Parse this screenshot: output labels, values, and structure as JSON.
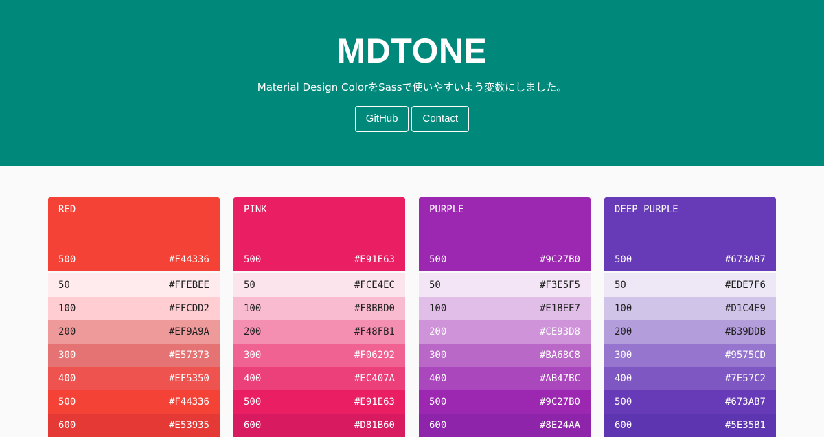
{
  "hero": {
    "title": "MDTONE",
    "subtitle": "Material Design ColorをSassで使いやすいよう変数にしました。",
    "background": "#00897B",
    "buttons": [
      {
        "label": "GitHub"
      },
      {
        "label": "Contact"
      }
    ]
  },
  "palettes": [
    {
      "name": "RED",
      "head": {
        "shade": "500",
        "hex": "#F44336"
      },
      "swatches": [
        {
          "shade": "50",
          "hex": "#FFEBEE"
        },
        {
          "shade": "100",
          "hex": "#FFCDD2"
        },
        {
          "shade": "200",
          "hex": "#EF9A9A"
        },
        {
          "shade": "300",
          "hex": "#E57373"
        },
        {
          "shade": "400",
          "hex": "#EF5350"
        },
        {
          "shade": "500",
          "hex": "#F44336"
        },
        {
          "shade": "600",
          "hex": "#E53935"
        }
      ]
    },
    {
      "name": "PINK",
      "head": {
        "shade": "500",
        "hex": "#E91E63"
      },
      "swatches": [
        {
          "shade": "50",
          "hex": "#FCE4EC"
        },
        {
          "shade": "100",
          "hex": "#F8BBD0"
        },
        {
          "shade": "200",
          "hex": "#F48FB1"
        },
        {
          "shade": "300",
          "hex": "#F06292"
        },
        {
          "shade": "400",
          "hex": "#EC407A"
        },
        {
          "shade": "500",
          "hex": "#E91E63"
        },
        {
          "shade": "600",
          "hex": "#D81B60"
        }
      ]
    },
    {
      "name": "PURPLE",
      "head": {
        "shade": "500",
        "hex": "#9C27B0"
      },
      "swatches": [
        {
          "shade": "50",
          "hex": "#F3E5F5"
        },
        {
          "shade": "100",
          "hex": "#E1BEE7"
        },
        {
          "shade": "200",
          "hex": "#CE93D8"
        },
        {
          "shade": "300",
          "hex": "#BA68C8"
        },
        {
          "shade": "400",
          "hex": "#AB47BC"
        },
        {
          "shade": "500",
          "hex": "#9C27B0"
        },
        {
          "shade": "600",
          "hex": "#8E24AA"
        }
      ]
    },
    {
      "name": "DEEP PURPLE",
      "head": {
        "shade": "500",
        "hex": "#673AB7"
      },
      "swatches": [
        {
          "shade": "50",
          "hex": "#EDE7F6"
        },
        {
          "shade": "100",
          "hex": "#D1C4E9"
        },
        {
          "shade": "200",
          "hex": "#B39DDB"
        },
        {
          "shade": "300",
          "hex": "#9575CD"
        },
        {
          "shade": "400",
          "hex": "#7E57C2"
        },
        {
          "shade": "500",
          "hex": "#673AB7"
        },
        {
          "shade": "600",
          "hex": "#5E35B1"
        }
      ]
    }
  ]
}
